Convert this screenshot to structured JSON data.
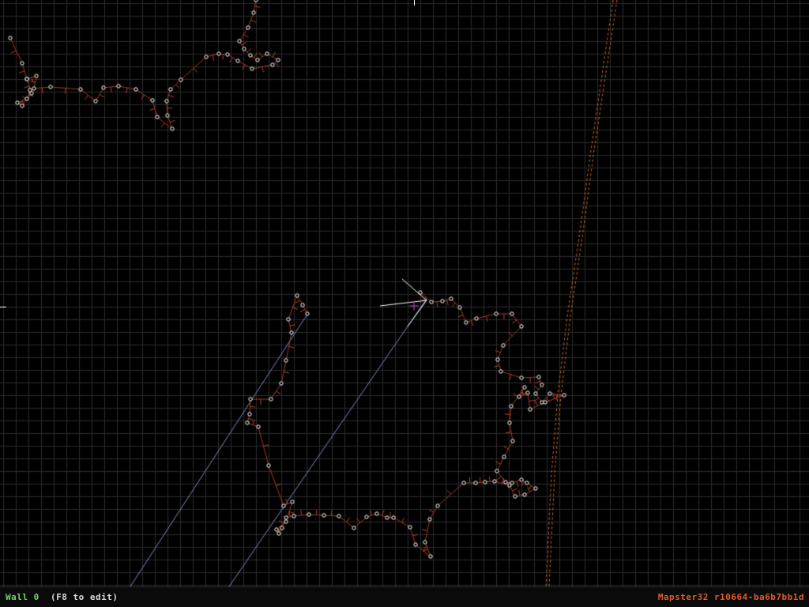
{
  "app": {
    "name": "Mapster32"
  },
  "status": {
    "wall_label": "Wall 0",
    "hint": "(F8 to edit)",
    "version": "Mapster32 r10664-ba6b7bb1d"
  },
  "colors": {
    "background": "#000000",
    "grid_line": "#2c2c2c",
    "wall": "#a33a24",
    "wall_normal": "#b0432a",
    "vertex": "#ffffff",
    "highlight_wall": "#ffffff",
    "sprite_line": "#7f8cc0",
    "cursor_cross": "#d040d0",
    "dotted_path": "#d0701f",
    "status_wall": "#74d36a",
    "status_hint": "#d8d8d8",
    "status_version": "#e05a2a"
  },
  "icons": {
    "player_cursor": "arrow-cursor-icon",
    "mouse_cursor": "crosshair-icon"
  }
}
